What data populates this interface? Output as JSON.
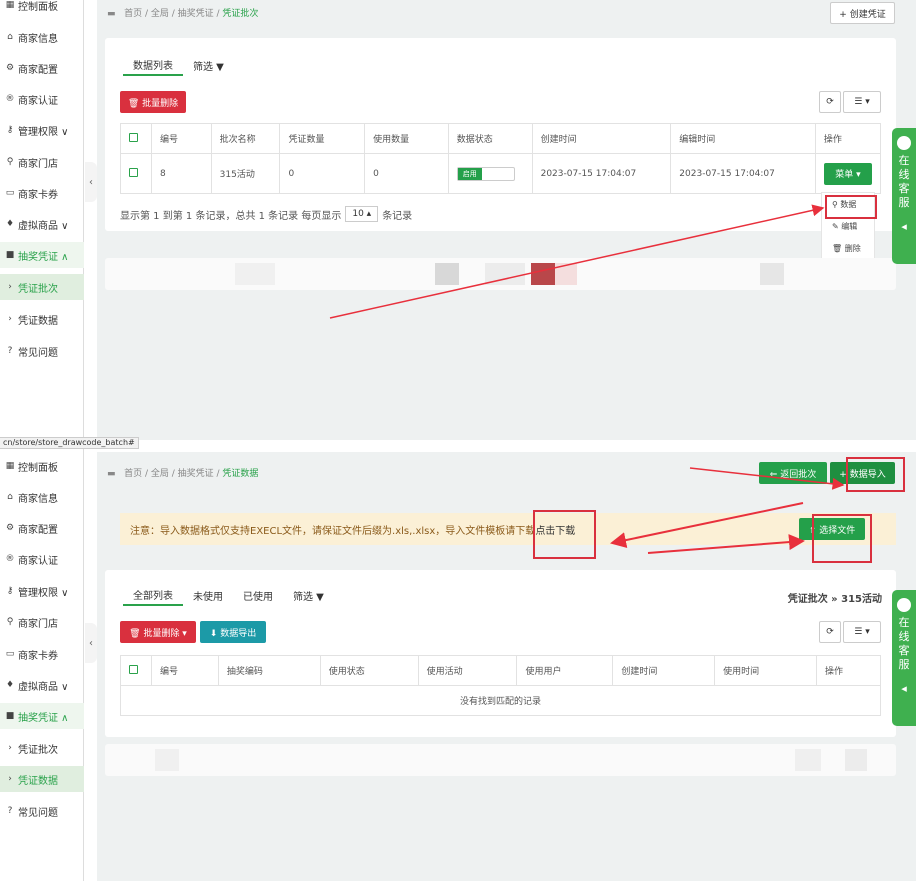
{
  "sidebar1": {
    "items": [
      {
        "icon": "dashboard-icon",
        "glyph": "▦",
        "label": "控制面板"
      },
      {
        "icon": "home-icon",
        "glyph": "⌂",
        "label": "商家信息"
      },
      {
        "icon": "gears-icon",
        "glyph": "⚙",
        "label": "商家配置"
      },
      {
        "icon": "registered-icon",
        "glyph": "®",
        "label": "商家认证"
      },
      {
        "icon": "key-icon",
        "glyph": "⚷",
        "label": "管理权限 ∨"
      },
      {
        "icon": "map-pin-icon",
        "glyph": "⚲",
        "label": "商家门店"
      },
      {
        "icon": "card-icon",
        "glyph": "▭",
        "label": "商家卡券"
      },
      {
        "icon": "gift-icon",
        "glyph": "♦",
        "label": "虚拟商品 ∨"
      },
      {
        "icon": "bookmark-icon",
        "glyph": "■",
        "label": "抽奖凭证 ∧"
      },
      {
        "icon": "chevron-right-icon",
        "glyph": "›",
        "label": "凭证批次"
      },
      {
        "icon": "chevron-right-icon",
        "glyph": "›",
        "label": "凭证数据"
      },
      {
        "icon": "question-icon",
        "glyph": "?",
        "label": "常见问题"
      }
    ]
  },
  "page1": {
    "breadcrumb": {
      "parent": "首页 / 全局 / 抽奖凭证 /",
      "current": "凭证批次"
    },
    "create_button": "+ 创建凭证",
    "tabs": [
      "数据列表",
      "筛选 ▼"
    ],
    "batch_delete": "🗑 批量删除",
    "refresh_glyph": "⟳",
    "columns_glyph": "☰ ▾",
    "headers": [
      "编号",
      "批次名称",
      "凭证数量",
      "使用数量",
      "数据状态",
      "创建时间",
      "编辑时间",
      "操作"
    ],
    "row": {
      "id": "8",
      "name": "315活动",
      "count": "0",
      "used": "0",
      "status": "启用",
      "created": "2023-07-15 17:04:07",
      "edited": "2023-07-15 17:04:07"
    },
    "menu_button": "菜单 ▾",
    "dropdown": [
      "⚲ 数据",
      "✎ 编辑",
      "🗑 删除"
    ],
    "pagination": {
      "prefix": "显示第 1 到第 1 条记录，总共 1 条记录  每页显示",
      "page_size": "10 ▴",
      "suffix": "条记录"
    }
  },
  "page2": {
    "url": "cn/store/store_drawcode_batch#",
    "breadcrumb": {
      "parent": "首页 / 全局 / 抽奖凭证 /",
      "current": "凭证数据"
    },
    "back_button": "⇐ 返回批次",
    "import_button": "+ 数据导入",
    "notice": "注意：导入数据格式仅支持EXECL文件，请保证文件后缀为.xls,.xlsx，导入文件模板请下载",
    "notice_link": "点击下载",
    "select_file": "⬆ 选择文件",
    "tabs": [
      "全部列表",
      "未使用",
      "已使用",
      "筛选 ▼"
    ],
    "batch_title": "凭证批次 » 315活动",
    "batch_delete": "🗑 批量删除 ▾",
    "export_button": "⬇ 数据导出",
    "refresh_glyph": "⟳",
    "columns_glyph": "☰ ▾",
    "headers": [
      "编号",
      "抽奖编码",
      "使用状态",
      "使用活动",
      "使用用户",
      "创建时间",
      "使用时间",
      "操作"
    ],
    "empty": "没有找到匹配的记录"
  },
  "service": {
    "label": [
      "在",
      "线",
      "客",
      "服"
    ],
    "arrow": "◂"
  },
  "colors": {
    "green": "#24a04a",
    "red": "#d9303e",
    "teal": "#1c9aa7",
    "notice_bg": "#fbf0d6"
  }
}
